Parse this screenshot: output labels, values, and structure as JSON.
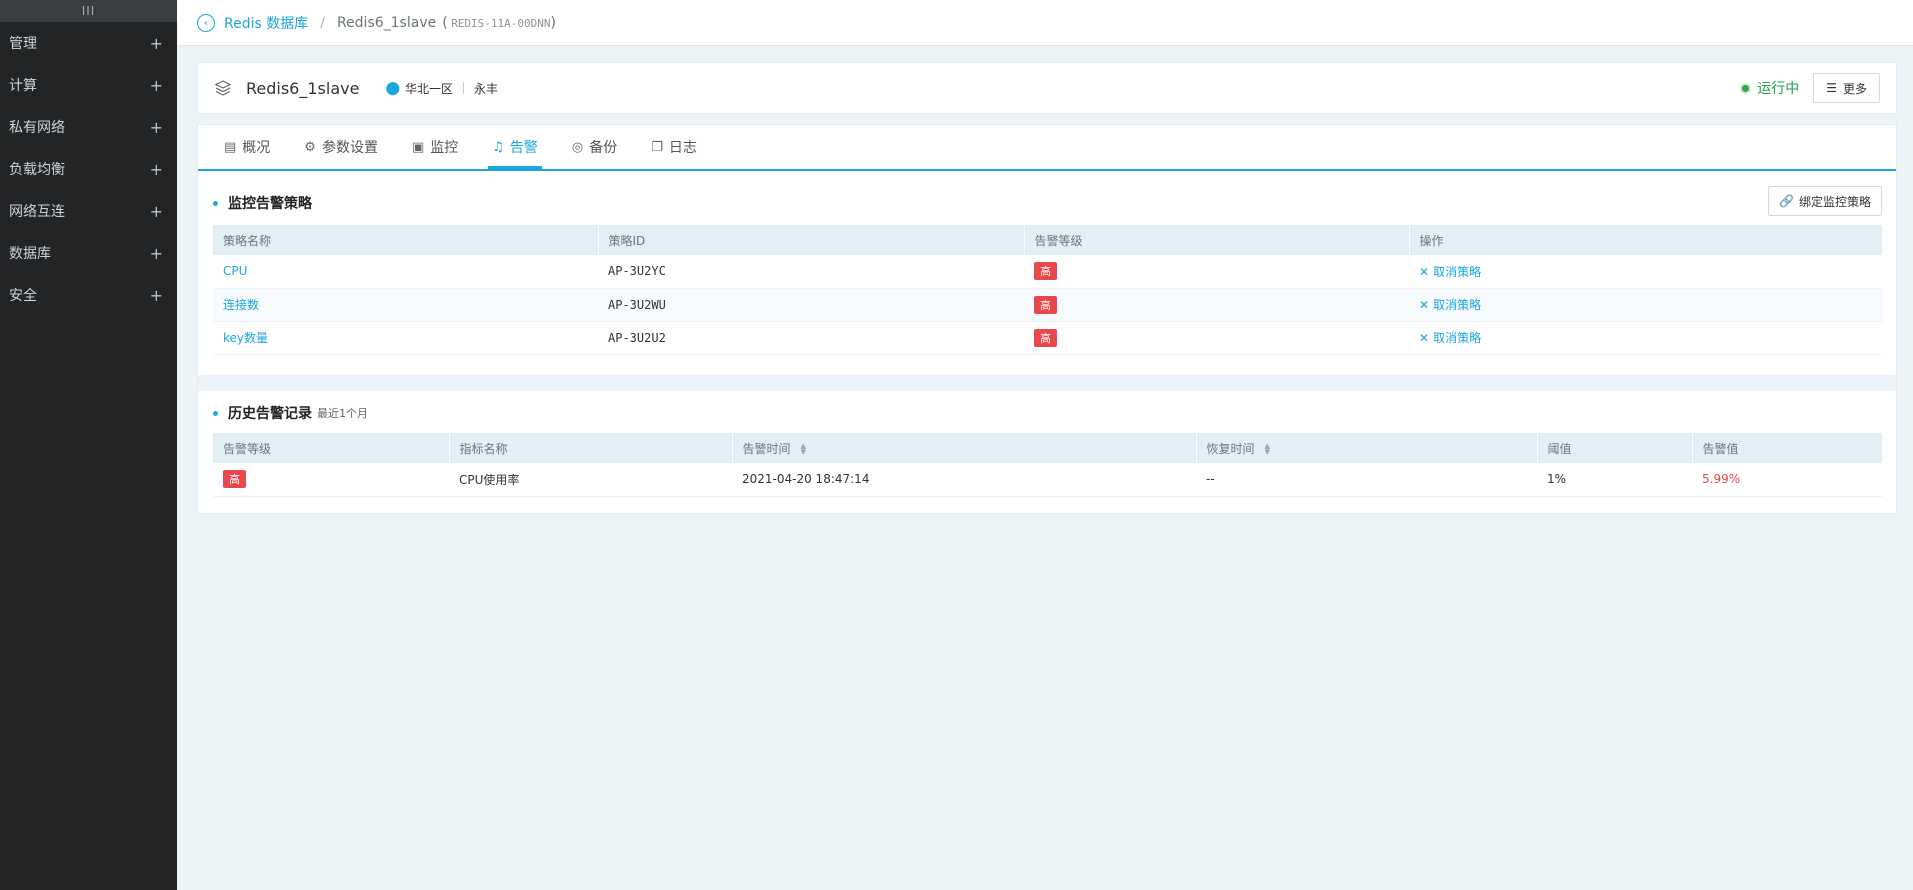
{
  "sidebar": {
    "handle": "III",
    "items": [
      {
        "label": "管理"
      },
      {
        "label": "计算"
      },
      {
        "label": "私有网络"
      },
      {
        "label": "负载均衡"
      },
      {
        "label": "网络互连"
      },
      {
        "label": "数据库"
      },
      {
        "label": "安全"
      }
    ],
    "expand_symbol": "+"
  },
  "header": {
    "back_link": "Redis 数据库",
    "separator": "/",
    "current": "Redis6_1slave",
    "id_open": "(",
    "id": "REDIS-11A-00DNN",
    "id_close": ")"
  },
  "instance": {
    "name": "Redis6_1slave",
    "region": "华北一区",
    "zone": "永丰",
    "status": "运行中",
    "status_color": "#1fa04a",
    "more_label": "更多"
  },
  "tabs": [
    {
      "label": "概况",
      "icon": "overview-icon"
    },
    {
      "label": "参数设置",
      "icon": "gear-icon"
    },
    {
      "label": "监控",
      "icon": "monitor-icon"
    },
    {
      "label": "告警",
      "icon": "bell-icon",
      "active": true
    },
    {
      "label": "备份",
      "icon": "camera-icon"
    },
    {
      "label": "日志",
      "icon": "log-icon"
    }
  ],
  "policy_section": {
    "title": "监控告警策略",
    "bind_button": "绑定监控策略",
    "columns": [
      "策略名称",
      "策略ID",
      "告警等级",
      "操作"
    ],
    "rows": [
      {
        "name": "CPU",
        "id": "AP-3U2YC",
        "level": "高",
        "action": "取消策略"
      },
      {
        "name": "连接数",
        "id": "AP-3U2WU",
        "level": "高",
        "action": "取消策略"
      },
      {
        "name": "key数量",
        "id": "AP-3U2U2",
        "level": "高",
        "action": "取消策略"
      }
    ]
  },
  "history_section": {
    "title": "历史告警记录",
    "subtitle": "最近1个月",
    "columns": [
      "告警等级",
      "指标名称",
      "告警时间",
      "恢复时间",
      "阈值",
      "告警值"
    ],
    "rows": [
      {
        "level": "高",
        "metric": "CPU使用率",
        "alert_time": "2021-04-20 18:47:14",
        "recover_time": "--",
        "threshold": "1%",
        "value": "5.99%"
      }
    ]
  },
  "colors": {
    "accent": "#1aa7e0",
    "danger": "#e8474d",
    "sidebar_bg": "#222426"
  }
}
